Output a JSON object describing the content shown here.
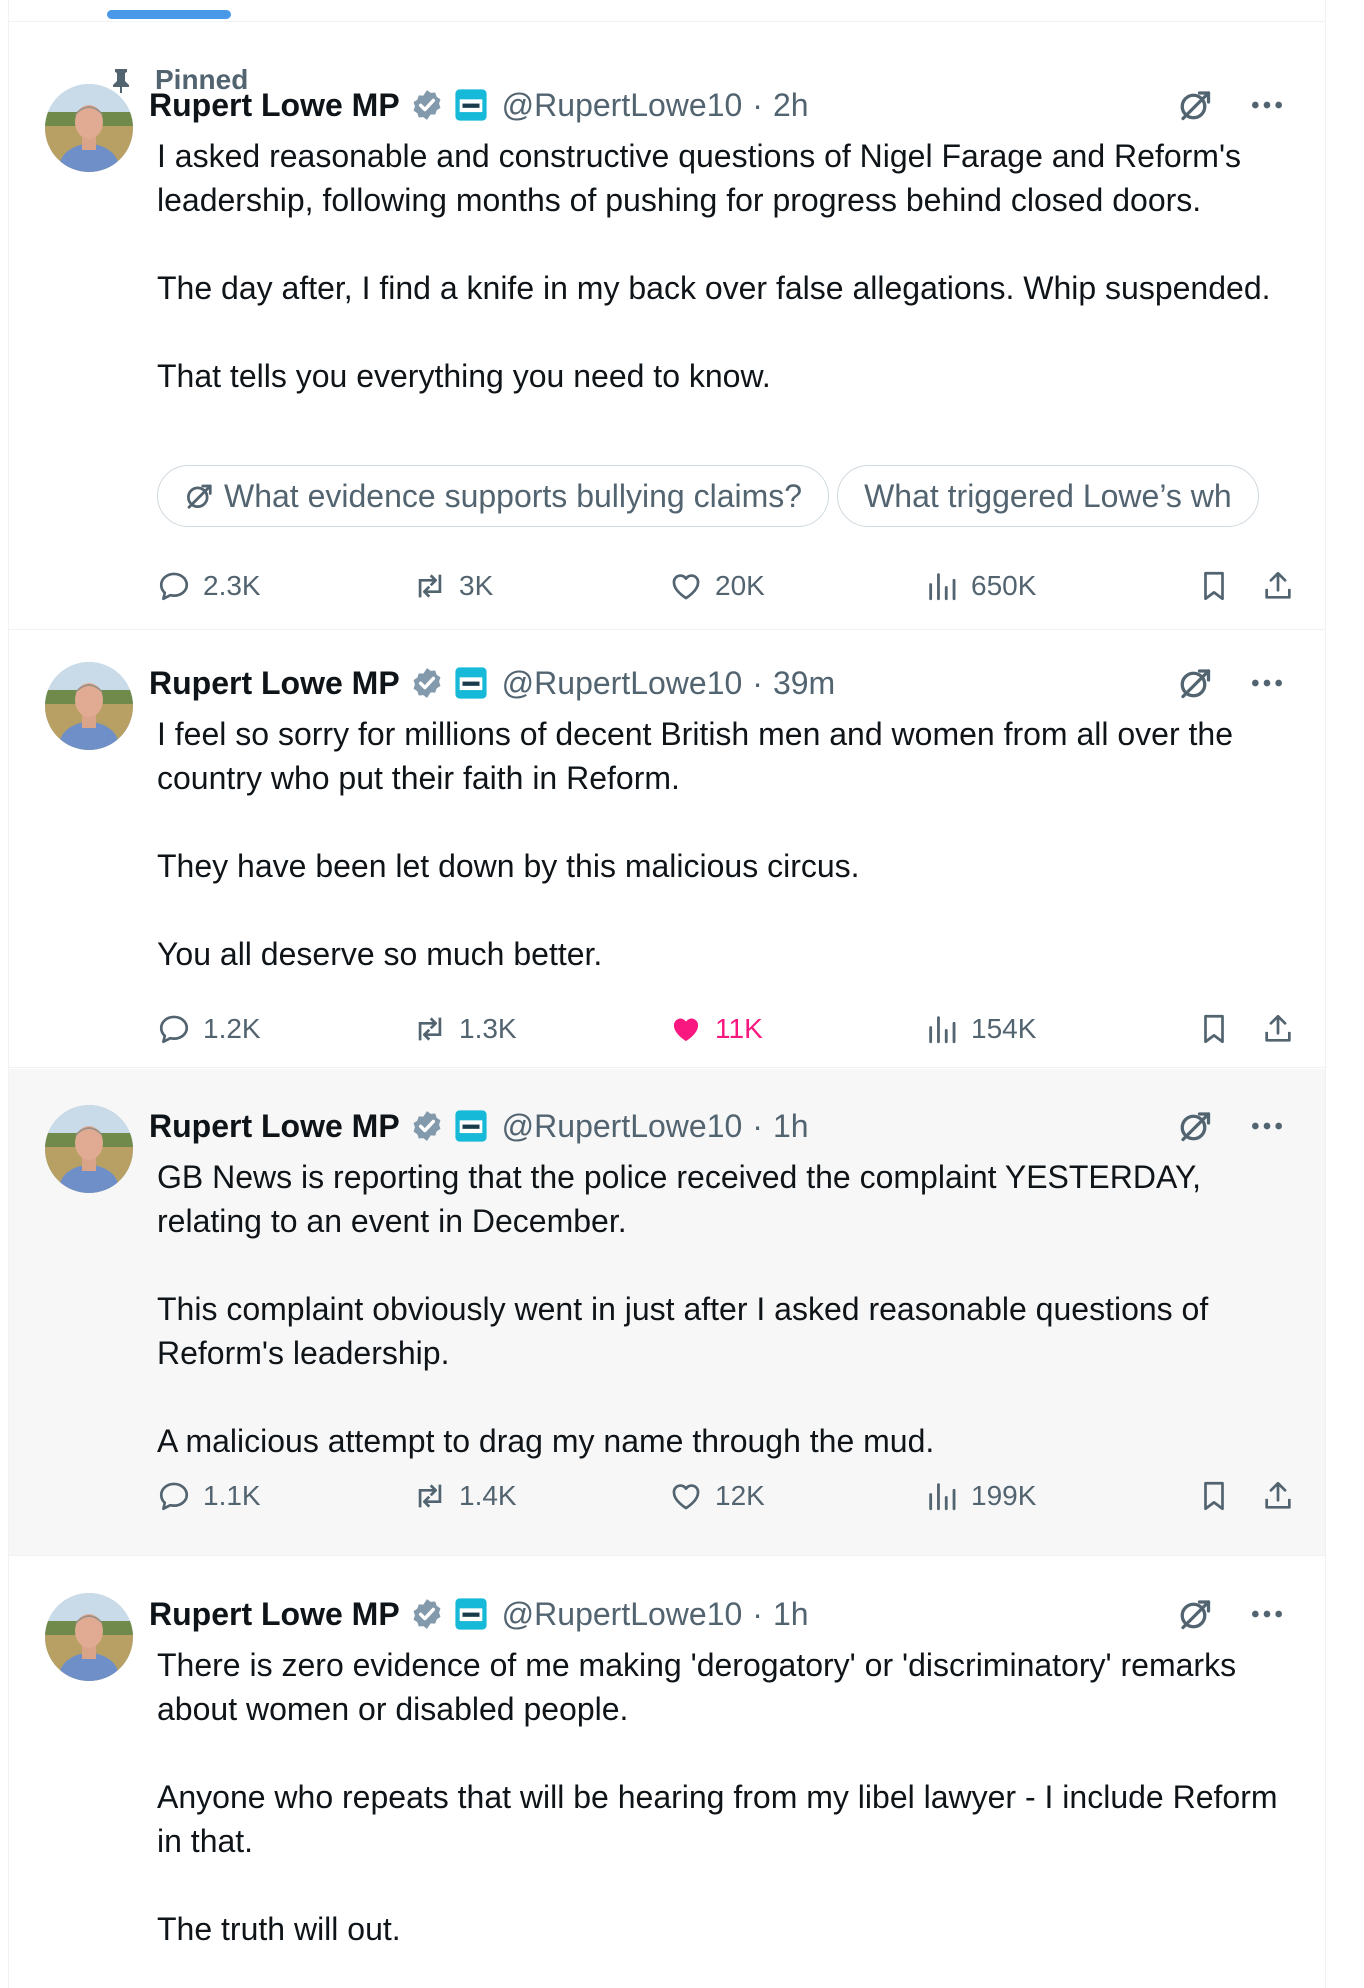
{
  "pinned_label": "Pinned",
  "author": {
    "name": "Rupert Lowe MP",
    "handle": "@RupertLowe10"
  },
  "tweets": [
    {
      "time": "2h",
      "paragraphs": [
        "I asked reasonable and constructive questions of Nigel Farage and Reform's leadership, following months of pushing for progress behind closed doors.",
        "The day after, I find a knife in my back over false allegations. Whip suspended.",
        "That tells you everything you need to know."
      ],
      "chips": [
        "What evidence supports bullying claims?",
        "What triggered Lowe’s wh"
      ],
      "replies": "2.3K",
      "reposts": "3K",
      "likes": "20K",
      "views": "650K",
      "liked": false
    },
    {
      "time": "39m",
      "paragraphs": [
        "I feel so sorry for millions of decent British men and women from all over the country who put their faith in Reform.",
        "They have been let down by this malicious circus.",
        "You all deserve so much better."
      ],
      "replies": "1.2K",
      "reposts": "1.3K",
      "likes": "11K",
      "views": "154K",
      "liked": true
    },
    {
      "time": "1h",
      "paragraphs": [
        "GB News is reporting that the police received the complaint YESTERDAY, relating to an event in December.",
        "This complaint obviously went in just after I asked reasonable questions of Reform's leadership.",
        "A malicious attempt to drag my name through the mud."
      ],
      "replies": "1.1K",
      "reposts": "1.4K",
      "likes": "12K",
      "views": "199K",
      "liked": false
    },
    {
      "time": "1h",
      "paragraphs": [
        "There is zero evidence of me making 'derogatory' or 'discriminatory' remarks about women or disabled people.",
        "Anyone who repeats that will be hearing from my libel lawyer - I include Reform in that.",
        "The truth will out."
      ]
    }
  ],
  "colors": {
    "accent": "#1d9bf0",
    "like_active": "#f91880",
    "muted": "#536471",
    "hover_bg": "#f7f7f7",
    "tab_indicator": "#4a99e9"
  },
  "icons": {
    "pinned": "pin-icon",
    "verified": "verified-badge-icon",
    "affiliate": "reform-affiliate-badge-icon",
    "grok": "grok-icon",
    "more": "more-dots-icon",
    "reply": "reply-icon",
    "repost": "repost-icon",
    "like": "heart-icon",
    "views": "views-bar-chart-icon",
    "bookmark": "bookmark-icon",
    "share": "share-icon"
  }
}
